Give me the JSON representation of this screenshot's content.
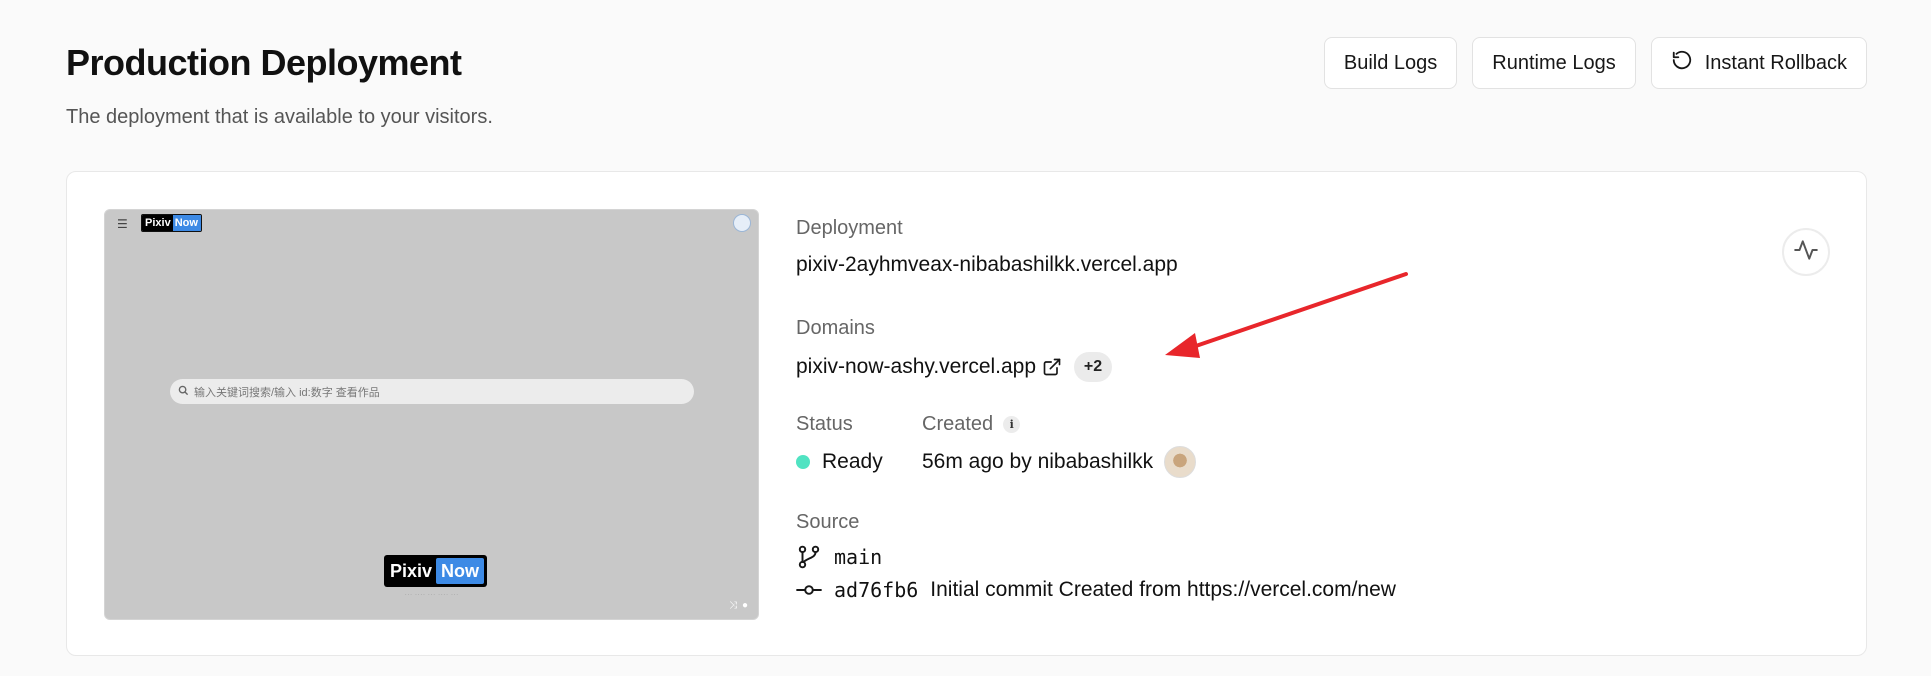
{
  "header": {
    "title": "Production Deployment",
    "subtitle": "The deployment that is available to your visitors.",
    "buttons": {
      "build_logs": "Build Logs",
      "runtime_logs": "Runtime Logs",
      "instant_rollback": "Instant Rollback"
    }
  },
  "preview": {
    "logo_left": "Pixiv",
    "logo_right": "Now",
    "search_placeholder": "输入关键词搜索/输入 id:数字 查看作品",
    "menu_glyph": "☰"
  },
  "details": {
    "deployment_label": "Deployment",
    "deployment_url": "pixiv-2ayhmveax-nibabashilkk.vercel.app",
    "domains_label": "Domains",
    "domain_url": "pixiv-now-ashy.vercel.app",
    "domain_extra_count": "+2",
    "status_label": "Status",
    "status_value": "Ready",
    "created_label": "Created",
    "created_value": "56m ago by nibabashilkk",
    "source_label": "Source",
    "branch": "main",
    "commit_hash": "ad76fb6",
    "commit_message": "Initial commit Created from https://vercel.com/new"
  },
  "colors": {
    "status_ready": "#50e3c2",
    "annotation_arrow": "#e8262b",
    "preview_logo_accent": "#3d8ae5"
  },
  "icons": {
    "rollback": "rollback-icon",
    "external_link": "external-link-icon",
    "info": "info-icon",
    "branch": "git-branch-icon",
    "commit": "git-commit-icon",
    "activity": "activity-icon"
  }
}
